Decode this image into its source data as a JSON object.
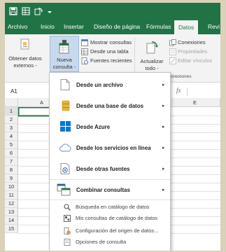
{
  "tabs": [
    {
      "label": "Archivo"
    },
    {
      "label": "Inicio"
    },
    {
      "label": "Insertar"
    },
    {
      "label": "Diseño de página"
    },
    {
      "label": "Fórmulas"
    },
    {
      "label": "Datos"
    },
    {
      "label": "Revi"
    }
  ],
  "ribbon": {
    "get_data_line1": "Obtener datos",
    "get_data_line2": "externos -",
    "new_query_line1": "Nueva",
    "new_query_line2": "consulta -",
    "show_queries": "Mostrar consultas",
    "from_table": "Desde una tabla",
    "recent_sources": "Fuentes recientes",
    "refresh_line1": "Actualizar",
    "refresh_line2": "todo -",
    "connections": "Conexiones",
    "properties": "Propiedades",
    "edit_links": "Editar vínculos",
    "group_connections": "onexiones"
  },
  "formula_bar": {
    "name_box": "A1",
    "fx": "fx"
  },
  "columns": [
    "A",
    "E"
  ],
  "rows": [
    "1",
    "2",
    "3",
    "4",
    "5",
    "6",
    "7",
    "8",
    "9",
    "10",
    "11",
    "12",
    "13",
    "14",
    "15"
  ],
  "menu": {
    "items": [
      {
        "label": "Desde un archivo"
      },
      {
        "label": "Desde una base de datos"
      },
      {
        "label": "Desde Azure"
      },
      {
        "label": "Desde los servicios en línea"
      },
      {
        "label": "Desde otras fuentes"
      },
      {
        "label": "Combinar consultas"
      }
    ],
    "secondary": [
      {
        "label": "Búsqueda en catálogo de datos"
      },
      {
        "label": "Mis consultas de catálogo de datos"
      },
      {
        "label": "Configuración del origen de datos..."
      },
      {
        "label": "Opciones de consulta"
      }
    ],
    "arrow": "▸"
  },
  "colors": {
    "excel_green": "#217346",
    "highlight": "#c8d9ec",
    "background": "#d9d2b9"
  }
}
